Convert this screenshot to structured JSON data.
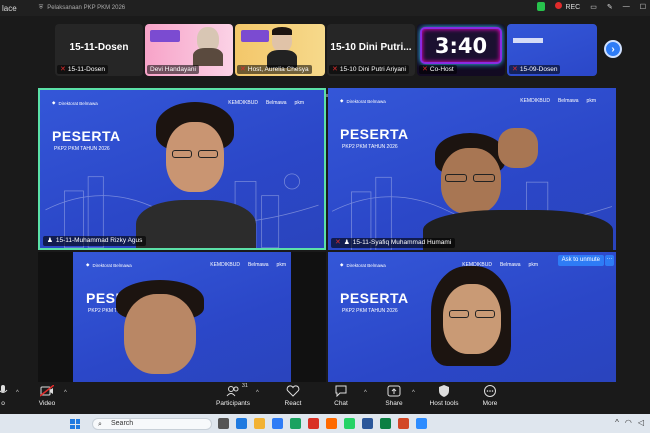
{
  "titlebar": {
    "app_name": "lace",
    "meeting_title": "Pelaksanaan PKP PKM 2026",
    "rec_label": "REC"
  },
  "strip": {
    "cards": [
      {
        "big": "15-11-Dosen",
        "label": "15-11-Dosen"
      },
      {
        "label": "Devi Handayani"
      },
      {
        "label": "Host, Aurelia Chesya"
      },
      {
        "big": "15-10 Dini Putri...",
        "label": "15-10 Dini Putri Ariyani"
      },
      {
        "timer": "3:40",
        "label": "Co-Host"
      },
      {
        "label": "15-09-Dosen"
      }
    ],
    "next_glyph": "›"
  },
  "tiles": [
    {
      "nametag": "15-11-Muhammad Rizky Agus",
      "title": "PESERTA",
      "subtitle": "PKP2 PKM TAHUN 2026",
      "org": "Direktorat Belmawa",
      "logos": [
        "KEMDIKBUD",
        "Belmawa",
        "pkm"
      ]
    },
    {
      "nametag": "15-11-Syafiq Muhammad Humami",
      "title": "PESERTA",
      "subtitle": "PKP2 PKM TAHUN 2026",
      "org": "Direktorat Belmawa",
      "logos": [
        "KEMDIKBUD",
        "Belmawa",
        "pkm"
      ]
    },
    {
      "nametag": "",
      "title": "PESERTA",
      "subtitle": "PKP2 PKM TAHUN 2026",
      "org": "Direktorat Belmawa",
      "logos": [
        "KEMDIKBUD",
        "Belmawa",
        "pkm"
      ]
    },
    {
      "nametag": "",
      "title": "PESERTA",
      "subtitle": "PKP2 PKM TAHUN 2026",
      "org": "Direktorat Belmawa",
      "logos": [
        "KEMDIKBUD",
        "Belmawa",
        "pkm"
      ],
      "unmute": "Ask to unmute",
      "more": "···"
    }
  ],
  "toolbar": {
    "items": [
      {
        "label": "o",
        "icon": "mic-icon"
      },
      {
        "label": "Video",
        "icon": "video-off-icon"
      },
      {
        "label": "Participants",
        "icon": "participants-icon",
        "count": "31"
      },
      {
        "label": "React",
        "icon": "heart-icon"
      },
      {
        "label": "Chat",
        "icon": "chat-icon"
      },
      {
        "label": "Share",
        "icon": "share-icon"
      },
      {
        "label": "Host tools",
        "icon": "shield-icon"
      },
      {
        "label": "More",
        "icon": "more-icon"
      }
    ],
    "caret": "^"
  },
  "taskbar": {
    "search_placeholder": "Search"
  },
  "colors": {
    "tile_blue": "#2d4fd1",
    "active_border": "#5be0a7",
    "accent_blue": "#2e7cf6",
    "rec_red": "#e02b2b"
  }
}
